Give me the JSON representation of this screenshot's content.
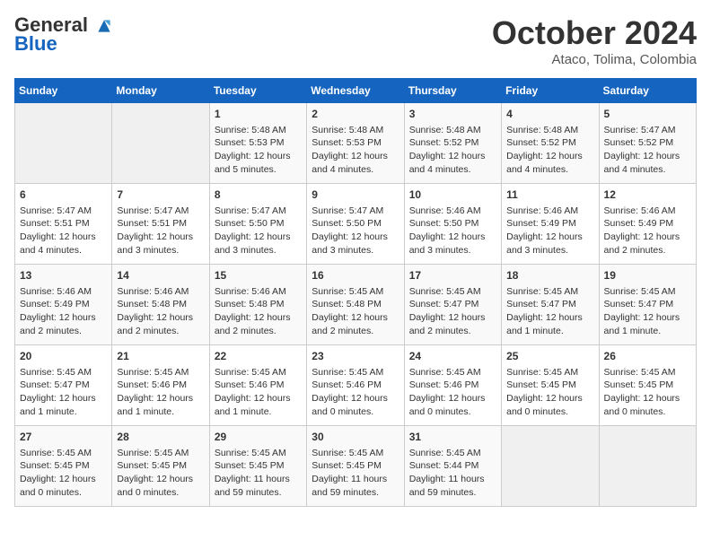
{
  "header": {
    "logo_line1": "General",
    "logo_line2": "Blue",
    "month": "October 2024",
    "location": "Ataco, Tolima, Colombia"
  },
  "days_of_week": [
    "Sunday",
    "Monday",
    "Tuesday",
    "Wednesday",
    "Thursday",
    "Friday",
    "Saturday"
  ],
  "weeks": [
    [
      {
        "day": "",
        "info": ""
      },
      {
        "day": "",
        "info": ""
      },
      {
        "day": "1",
        "info": "Sunrise: 5:48 AM\nSunset: 5:53 PM\nDaylight: 12 hours and 5 minutes."
      },
      {
        "day": "2",
        "info": "Sunrise: 5:48 AM\nSunset: 5:53 PM\nDaylight: 12 hours and 4 minutes."
      },
      {
        "day": "3",
        "info": "Sunrise: 5:48 AM\nSunset: 5:52 PM\nDaylight: 12 hours and 4 minutes."
      },
      {
        "day": "4",
        "info": "Sunrise: 5:48 AM\nSunset: 5:52 PM\nDaylight: 12 hours and 4 minutes."
      },
      {
        "day": "5",
        "info": "Sunrise: 5:47 AM\nSunset: 5:52 PM\nDaylight: 12 hours and 4 minutes."
      }
    ],
    [
      {
        "day": "6",
        "info": "Sunrise: 5:47 AM\nSunset: 5:51 PM\nDaylight: 12 hours and 4 minutes."
      },
      {
        "day": "7",
        "info": "Sunrise: 5:47 AM\nSunset: 5:51 PM\nDaylight: 12 hours and 3 minutes."
      },
      {
        "day": "8",
        "info": "Sunrise: 5:47 AM\nSunset: 5:50 PM\nDaylight: 12 hours and 3 minutes."
      },
      {
        "day": "9",
        "info": "Sunrise: 5:47 AM\nSunset: 5:50 PM\nDaylight: 12 hours and 3 minutes."
      },
      {
        "day": "10",
        "info": "Sunrise: 5:46 AM\nSunset: 5:50 PM\nDaylight: 12 hours and 3 minutes."
      },
      {
        "day": "11",
        "info": "Sunrise: 5:46 AM\nSunset: 5:49 PM\nDaylight: 12 hours and 3 minutes."
      },
      {
        "day": "12",
        "info": "Sunrise: 5:46 AM\nSunset: 5:49 PM\nDaylight: 12 hours and 2 minutes."
      }
    ],
    [
      {
        "day": "13",
        "info": "Sunrise: 5:46 AM\nSunset: 5:49 PM\nDaylight: 12 hours and 2 minutes."
      },
      {
        "day": "14",
        "info": "Sunrise: 5:46 AM\nSunset: 5:48 PM\nDaylight: 12 hours and 2 minutes."
      },
      {
        "day": "15",
        "info": "Sunrise: 5:46 AM\nSunset: 5:48 PM\nDaylight: 12 hours and 2 minutes."
      },
      {
        "day": "16",
        "info": "Sunrise: 5:45 AM\nSunset: 5:48 PM\nDaylight: 12 hours and 2 minutes."
      },
      {
        "day": "17",
        "info": "Sunrise: 5:45 AM\nSunset: 5:47 PM\nDaylight: 12 hours and 2 minutes."
      },
      {
        "day": "18",
        "info": "Sunrise: 5:45 AM\nSunset: 5:47 PM\nDaylight: 12 hours and 1 minute."
      },
      {
        "day": "19",
        "info": "Sunrise: 5:45 AM\nSunset: 5:47 PM\nDaylight: 12 hours and 1 minute."
      }
    ],
    [
      {
        "day": "20",
        "info": "Sunrise: 5:45 AM\nSunset: 5:47 PM\nDaylight: 12 hours and 1 minute."
      },
      {
        "day": "21",
        "info": "Sunrise: 5:45 AM\nSunset: 5:46 PM\nDaylight: 12 hours and 1 minute."
      },
      {
        "day": "22",
        "info": "Sunrise: 5:45 AM\nSunset: 5:46 PM\nDaylight: 12 hours and 1 minute."
      },
      {
        "day": "23",
        "info": "Sunrise: 5:45 AM\nSunset: 5:46 PM\nDaylight: 12 hours and 0 minutes."
      },
      {
        "day": "24",
        "info": "Sunrise: 5:45 AM\nSunset: 5:46 PM\nDaylight: 12 hours and 0 minutes."
      },
      {
        "day": "25",
        "info": "Sunrise: 5:45 AM\nSunset: 5:45 PM\nDaylight: 12 hours and 0 minutes."
      },
      {
        "day": "26",
        "info": "Sunrise: 5:45 AM\nSunset: 5:45 PM\nDaylight: 12 hours and 0 minutes."
      }
    ],
    [
      {
        "day": "27",
        "info": "Sunrise: 5:45 AM\nSunset: 5:45 PM\nDaylight: 12 hours and 0 minutes."
      },
      {
        "day": "28",
        "info": "Sunrise: 5:45 AM\nSunset: 5:45 PM\nDaylight: 12 hours and 0 minutes."
      },
      {
        "day": "29",
        "info": "Sunrise: 5:45 AM\nSunset: 5:45 PM\nDaylight: 11 hours and 59 minutes."
      },
      {
        "day": "30",
        "info": "Sunrise: 5:45 AM\nSunset: 5:45 PM\nDaylight: 11 hours and 59 minutes."
      },
      {
        "day": "31",
        "info": "Sunrise: 5:45 AM\nSunset: 5:44 PM\nDaylight: 11 hours and 59 minutes."
      },
      {
        "day": "",
        "info": ""
      },
      {
        "day": "",
        "info": ""
      }
    ]
  ]
}
